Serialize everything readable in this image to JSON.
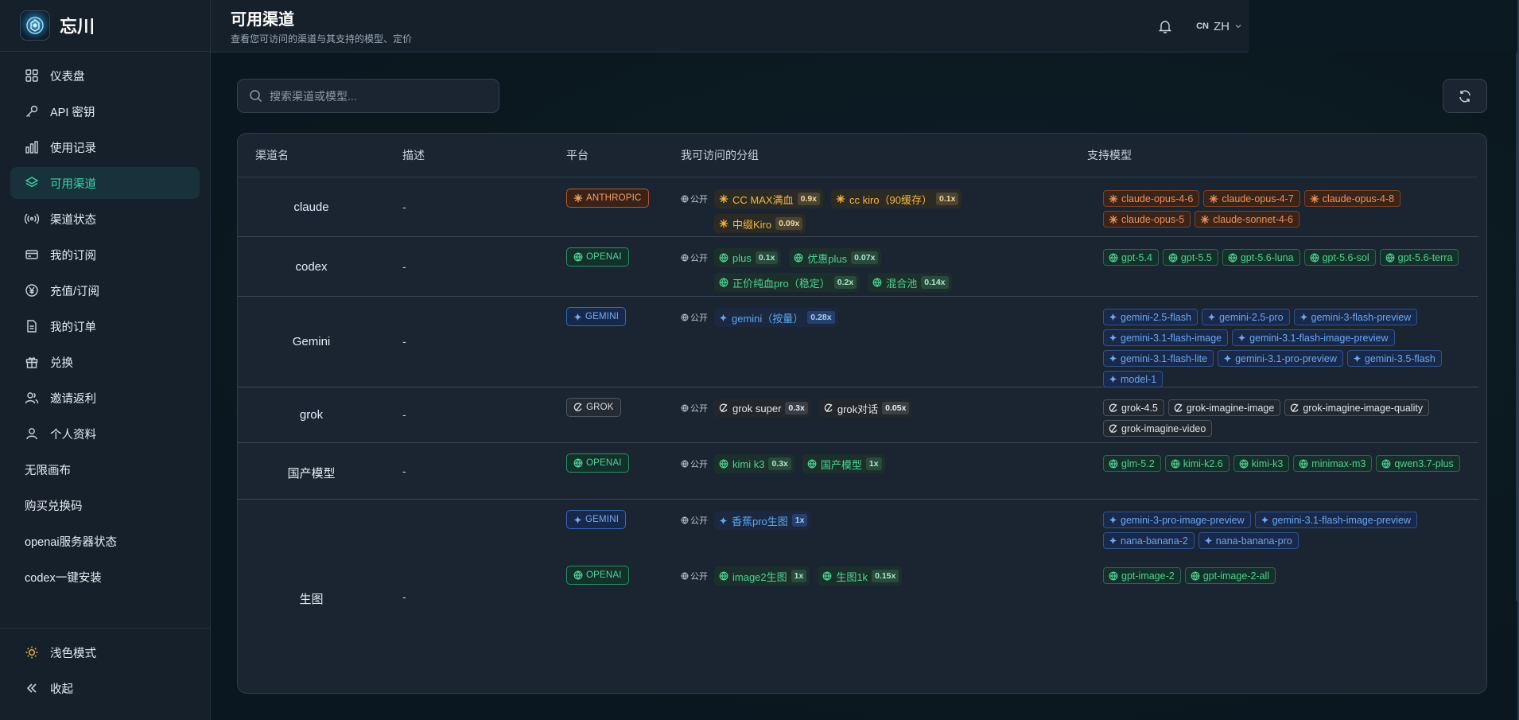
{
  "brand": {
    "name": "忘川"
  },
  "sidebar": {
    "items": [
      {
        "label": "仪表盘",
        "icon": "dashboard-icon"
      },
      {
        "label": "API 密钥",
        "icon": "key-icon"
      },
      {
        "label": "使用记录",
        "icon": "bar-chart-icon"
      },
      {
        "label": "可用渠道",
        "icon": "layers-icon",
        "active": true
      },
      {
        "label": "渠道状态",
        "icon": "signal-icon"
      },
      {
        "label": "我的订阅",
        "icon": "credit-card-icon"
      },
      {
        "label": "充值/订阅",
        "icon": "yen-icon"
      },
      {
        "label": "我的订单",
        "icon": "document-icon"
      },
      {
        "label": "兑换",
        "icon": "gift-icon"
      },
      {
        "label": "邀请返利",
        "icon": "users-icon"
      },
      {
        "label": "个人资料",
        "icon": "user-icon"
      }
    ],
    "links": [
      "无限画布",
      "购买兑换码",
      "openai服务器状态",
      "codex一键安装"
    ],
    "footer": {
      "theme_label": "浅色模式",
      "collapse_label": "收起"
    }
  },
  "header": {
    "title": "可用渠道",
    "subtitle": "查看您可访问的渠道与其支持的模型、定价",
    "lang_flag": "CN",
    "lang_code": "ZH"
  },
  "search": {
    "placeholder": "搜索渠道或模型..."
  },
  "table": {
    "headers": {
      "name": "渠道名",
      "desc": "描述",
      "platform": "平台",
      "groups": "我可访问的分组",
      "models": "支持模型"
    },
    "public_label": "公开",
    "rows": [
      {
        "name": "claude",
        "desc": "-",
        "platforms": [
          {
            "label": "ANTHROPIC",
            "groups": [
              {
                "name": "CC MAX满血",
                "mult": "0.9x"
              },
              {
                "name": "cc kiro（90缓存）",
                "mult": "0.1x"
              },
              {
                "name": "中缀Kiro",
                "mult": "0.09x"
              }
            ],
            "models": [
              "claude-opus-4-6",
              "claude-opus-4-7",
              "claude-opus-4-8",
              "claude-opus-5",
              "claude-sonnet-4-6"
            ]
          }
        ]
      },
      {
        "name": "codex",
        "desc": "-",
        "platforms": [
          {
            "label": "OPENAI",
            "groups": [
              {
                "name": "plus",
                "mult": "0.1x"
              },
              {
                "name": "优惠plus",
                "mult": "0.07x"
              },
              {
                "name": "正价纯血pro（稳定）",
                "mult": "0.2x"
              },
              {
                "name": "混合池",
                "mult": "0.14x"
              }
            ],
            "models": [
              "gpt-5.4",
              "gpt-5.5",
              "gpt-5.6-luna",
              "gpt-5.6-sol",
              "gpt-5.6-terra"
            ]
          }
        ]
      },
      {
        "name": "Gemini",
        "desc": "-",
        "platforms": [
          {
            "label": "GEMINI",
            "groups": [
              {
                "name": "gemini（按量）",
                "mult": "0.28x"
              }
            ],
            "models": [
              "gemini-2.5-flash",
              "gemini-2.5-pro",
              "gemini-3-flash-preview",
              "gemini-3.1-flash-image",
              "gemini-3.1-flash-image-preview",
              "gemini-3.1-flash-lite",
              "gemini-3.1-pro-preview",
              "gemini-3.5-flash",
              "model-1"
            ]
          }
        ]
      },
      {
        "name": "grok",
        "desc": "-",
        "platforms": [
          {
            "label": "GROK",
            "groups": [
              {
                "name": "grok super",
                "mult": "0.3x"
              },
              {
                "name": "grok对话",
                "mult": "0.05x"
              }
            ],
            "models": [
              "grok-4.5",
              "grok-imagine-image",
              "grok-imagine-image-quality",
              "grok-imagine-video"
            ]
          }
        ]
      },
      {
        "name": "国产模型",
        "desc": "-",
        "platforms": [
          {
            "label": "OPENAI",
            "groups": [
              {
                "name": "kimi k3",
                "mult": "0.3x"
              },
              {
                "name": "国产模型",
                "mult": "1x"
              }
            ],
            "models": [
              "glm-5.2",
              "kimi-k2.6",
              "kimi-k3",
              "minimax-m3",
              "qwen3.7-plus"
            ]
          }
        ]
      },
      {
        "name": "生图",
        "desc": "-",
        "platforms": [
          {
            "label": "GEMINI",
            "groups": [
              {
                "name": "香蕉pro生图",
                "mult": "1x"
              }
            ],
            "models": [
              "gemini-3-pro-image-preview",
              "gemini-3.1-flash-image-preview",
              "nana-banana-2",
              "nana-banana-pro"
            ]
          },
          {
            "label": "OPENAI",
            "groups": [
              {
                "name": "image2生图",
                "mult": "1x"
              },
              {
                "name": "生图1k",
                "mult": "0.15x"
              }
            ],
            "models": [
              "gpt-image-2",
              "gpt-image-2-all"
            ]
          }
        ]
      }
    ]
  }
}
